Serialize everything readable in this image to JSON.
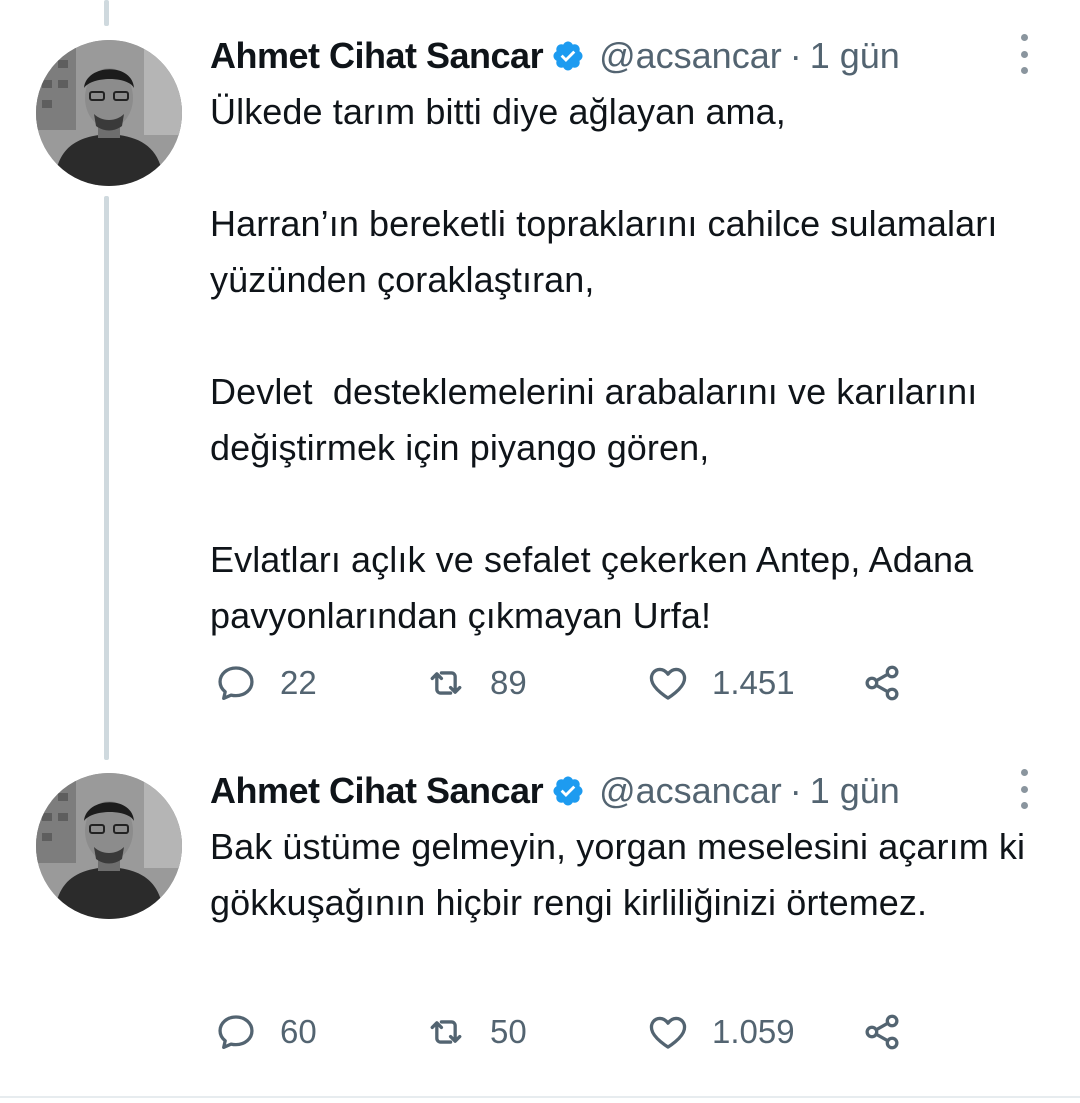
{
  "colors": {
    "text": "#0f1419",
    "secondary": "#536471",
    "verified": "#1d9bf0",
    "thread_line": "#cfd9de"
  },
  "tweets": [
    {
      "author_name": "Ahmet Cihat Sancar",
      "verified_icon": "verified-badge-icon",
      "handle": "@acsancar",
      "separator": "·",
      "time": "1 gün",
      "text": "Ülkede tarım bitti diye ağlayan ama,\n\nHarran’ın bereketli topraklarını cahilce sulamaları yüzünden çoraklaştıran,\n\nDevlet  desteklemelerini arabalarını ve karılarını değiştirmek için piyango gören,\n\nEvlatları açlık ve sefalet çekerken Antep, Adana pavyonlarından çıkmayan Urfa!",
      "replies": "22",
      "retweets": "89",
      "likes": "1.451"
    },
    {
      "author_name": "Ahmet Cihat Sancar",
      "verified_icon": "verified-badge-icon",
      "handle": "@acsancar",
      "separator": "·",
      "time": "1 gün",
      "text": "Bak üstüme gelmeyin, yorgan meselesini açarım ki gökkuşağının hiçbir rengi kirliliğinizi örtemez.",
      "replies": "60",
      "retweets": "50",
      "likes": "1.059"
    }
  ]
}
